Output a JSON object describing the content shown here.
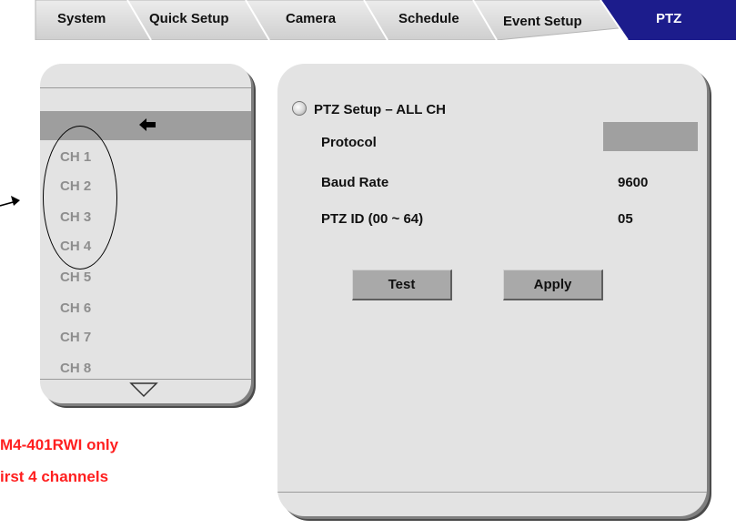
{
  "tabs": [
    {
      "id": "system",
      "label": "System"
    },
    {
      "id": "quick-setup",
      "label": "Quick Setup"
    },
    {
      "id": "camera",
      "label": "Camera"
    },
    {
      "id": "schedule",
      "label": "Schedule"
    },
    {
      "id": "event-setup",
      "label": "Event Setup"
    },
    {
      "id": "ptz",
      "label": "PTZ",
      "active": true
    }
  ],
  "channel_list": {
    "back_icon": "arrow-left-icon",
    "items": [
      "CH 1",
      "CH 2",
      "CH 3",
      "CH 4",
      "CH 5",
      "CH 6",
      "CH 7",
      "CH 8"
    ],
    "scroll_icon": "triangle-down-icon"
  },
  "note": {
    "line1": "M4-401RWI only",
    "line2": "irst 4 channels"
  },
  "ptz_setup": {
    "title": "PTZ Setup – ALL CH",
    "fields": [
      {
        "label": "Protocol",
        "value": ""
      },
      {
        "label": "Baud Rate",
        "value": "9600"
      },
      {
        "label": "PTZ ID (00 ~ 64)",
        "value": "05"
      }
    ],
    "test_label": "Test",
    "apply_label": "Apply"
  },
  "colors": {
    "active_tab": "#1c1c8c",
    "tab": "#d8d8d8",
    "panel": "#e3e3e3",
    "highlight_row": "#9e9e9e",
    "note_text": "#ff1f1f"
  }
}
